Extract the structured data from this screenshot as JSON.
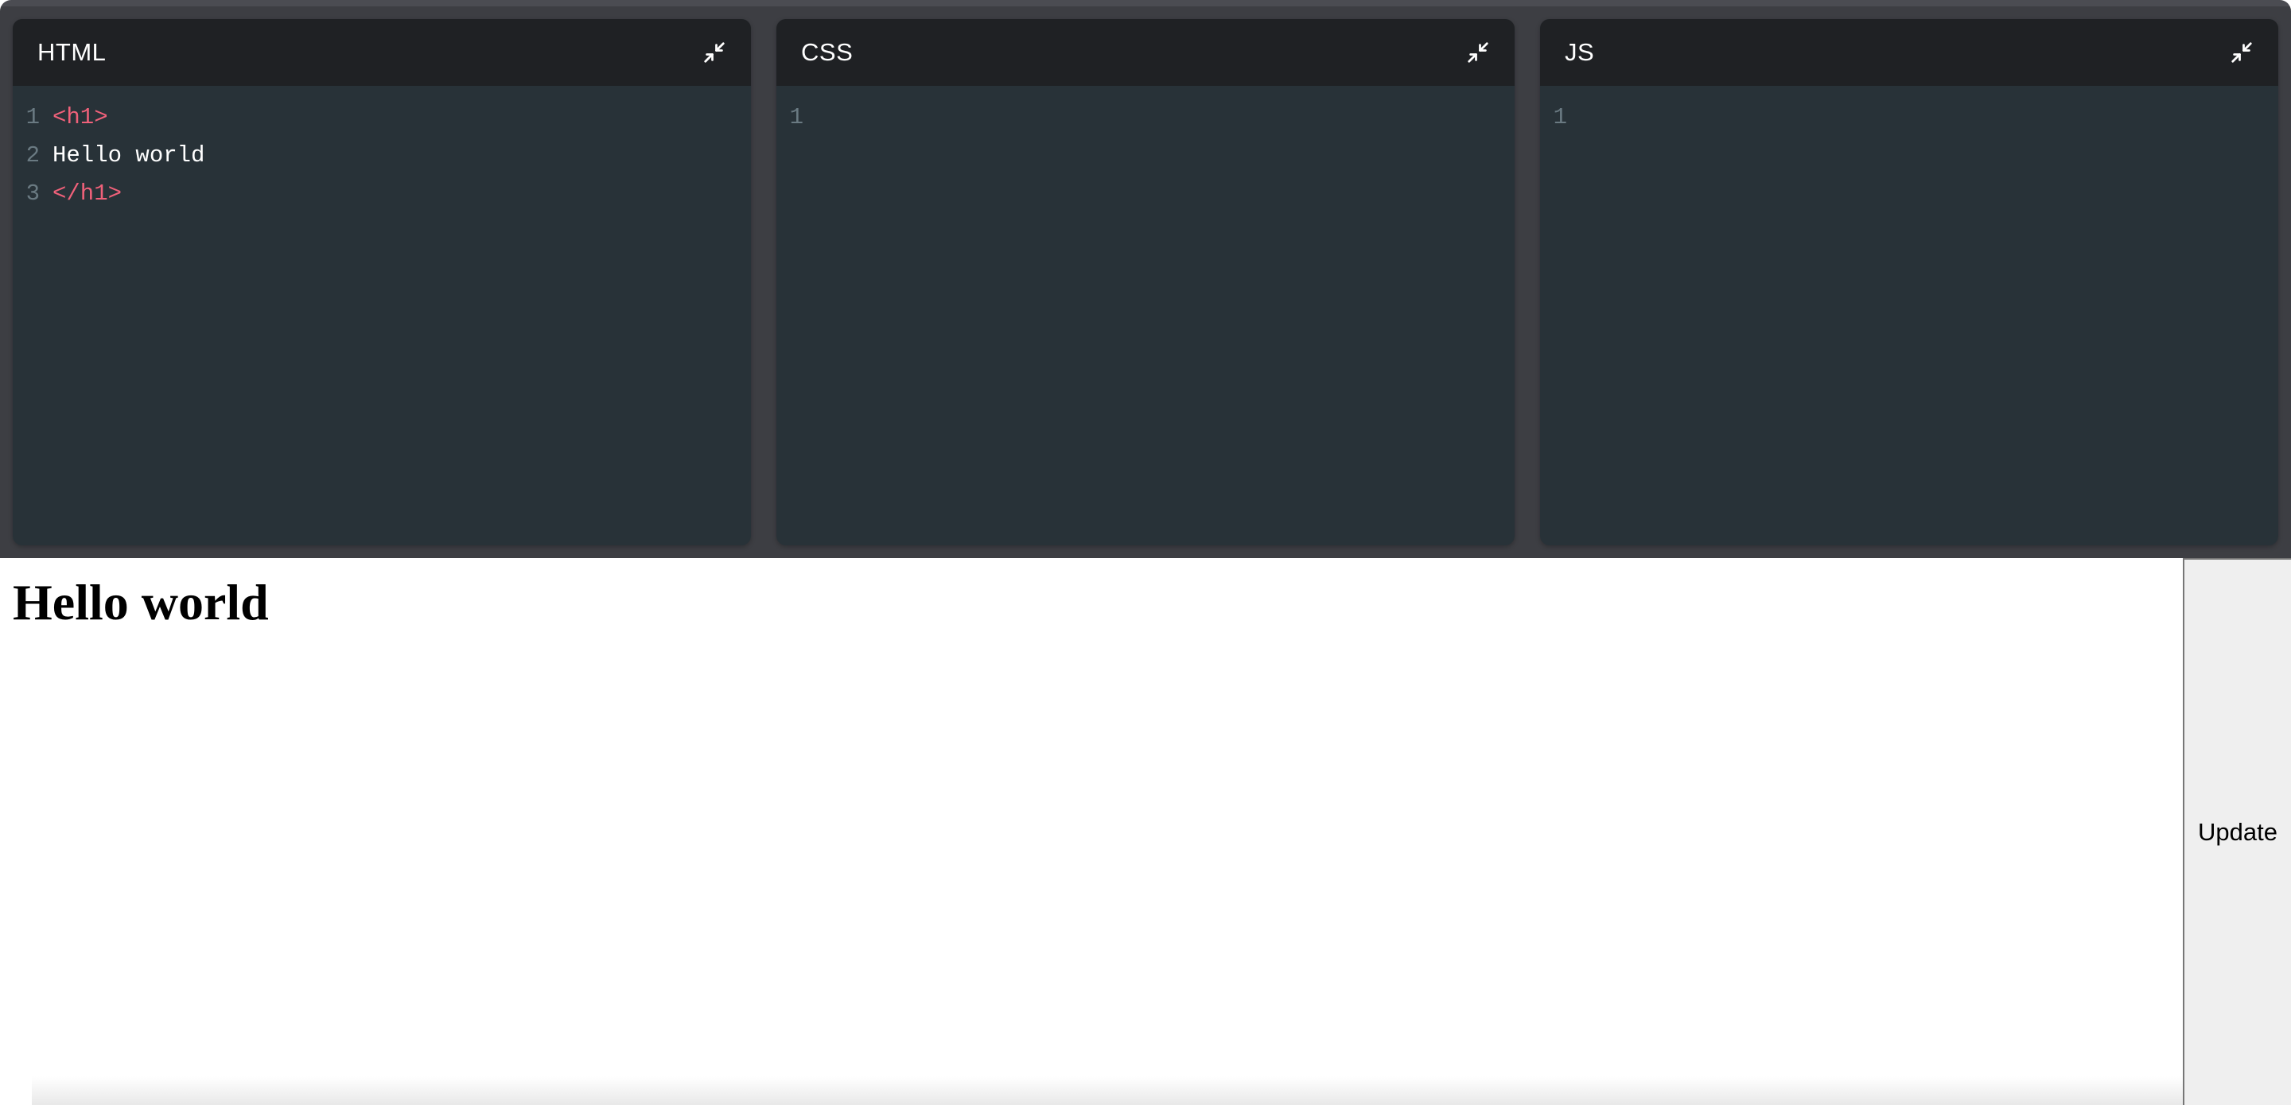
{
  "editors": [
    {
      "title": "HTML",
      "lines": [
        [
          {
            "text": "<h1>",
            "type": "tag"
          }
        ],
        [
          {
            "text": "Hello world",
            "type": "text"
          }
        ],
        [
          {
            "text": "</h1>",
            "type": "tag"
          }
        ]
      ]
    },
    {
      "title": "CSS",
      "lines": [
        []
      ]
    },
    {
      "title": "JS",
      "lines": [
        []
      ]
    }
  ],
  "collapse_icon": "collapse-arrows-icon",
  "preview": {
    "heading": "Hello world"
  },
  "update_button": {
    "label": "Update"
  },
  "colors": {
    "editor_bg": "#283238",
    "header_bg": "#1f2124",
    "tag": "#f0617a",
    "text": "#ffffff",
    "line_number": "#6a7a82"
  }
}
